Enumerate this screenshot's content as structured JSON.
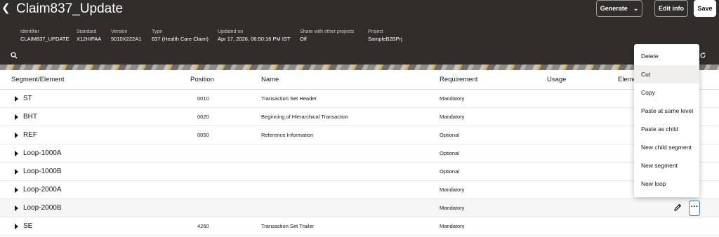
{
  "header": {
    "title": "Claim837_Update",
    "back_icon": "chevron-left-icon",
    "buttons": {
      "generate": "Generate",
      "edit_info": "Edit info",
      "save": "Save"
    },
    "meta": [
      {
        "label": "Identifier",
        "value": "CLAIM837_UPDATE"
      },
      {
        "label": "Standard",
        "value": "X12HIPAA"
      },
      {
        "label": "Version",
        "value": "5010X222A1"
      },
      {
        "label": "Type",
        "value": "837 (Health Care Claim)"
      },
      {
        "label": "Updated on",
        "value": "Apr 17, 2026, 06:50:16 PM IST"
      },
      {
        "label": "Share with other projects",
        "value": "Off"
      },
      {
        "label": "Project",
        "value": "SampleB2BPrj"
      }
    ]
  },
  "table": {
    "columns": [
      "Segment/Element",
      "Position",
      "Name",
      "Requirement",
      "Usage",
      "Eleme"
    ],
    "rows": [
      {
        "segment": "ST",
        "position": "0010",
        "name": "Transaction Set Header",
        "requirement": "Mandatory"
      },
      {
        "segment": "BHT",
        "position": "0020",
        "name": "Beginning of Hierarchical Transaction",
        "requirement": "Mandatory"
      },
      {
        "segment": "REF",
        "position": "0050",
        "name": "Reference Information",
        "requirement": "Optional"
      },
      {
        "segment": "Loop-1000A",
        "position": "",
        "name": "",
        "requirement": "Optional"
      },
      {
        "segment": "Loop-1000B",
        "position": "",
        "name": "",
        "requirement": "Optional"
      },
      {
        "segment": "Loop-2000A",
        "position": "",
        "name": "",
        "requirement": "Mandatory"
      },
      {
        "segment": "Loop-2000B",
        "position": "",
        "name": "",
        "requirement": "Mandatory"
      },
      {
        "segment": "SE",
        "position": "4260",
        "name": "Transaction Set Trailer",
        "requirement": "Mandatory"
      }
    ],
    "more_label": "···"
  },
  "context_menu": {
    "items": [
      "Delete",
      "Cut",
      "Copy",
      "Paste at same level",
      "Paste as child",
      "New child segment",
      "New segment",
      "New loop"
    ],
    "highlighted": "Cut"
  },
  "colors": {
    "header_bg": "#312d2a",
    "focus_border": "#3f7cb9",
    "menu_hover": "#f1efed"
  }
}
